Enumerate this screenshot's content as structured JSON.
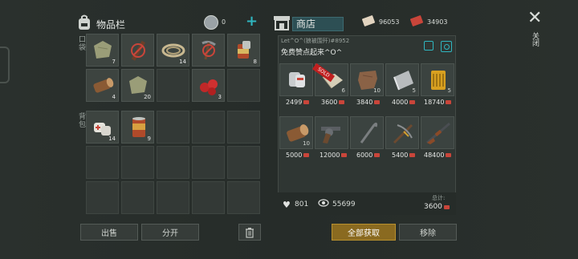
{
  "inventory": {
    "title": "物品栏",
    "coins": "0",
    "add_label": "+",
    "pocket_label": "口袋",
    "backpack_label": "背包",
    "pocket_counts": [
      "7",
      "",
      "14",
      "",
      "8",
      "4",
      "20",
      "",
      "3",
      ""
    ],
    "backpack_counts": [
      "14",
      "9"
    ]
  },
  "shop": {
    "title": "商店",
    "currency1": "96053",
    "currency2": "34903",
    "seller": "Let^O^(狼被围歼)",
    "seller_id": "#8952",
    "message": "免费赞点起来^O^",
    "sold_badge": "SOLD",
    "row1_counts": [
      "",
      "6",
      "10",
      "5",
      "5"
    ],
    "row1_prices": [
      "2499",
      "3600",
      "3840",
      "4000",
      "18740"
    ],
    "row2_counts": [
      "10",
      "",
      "",
      "",
      ""
    ],
    "row2_prices": [
      "5000",
      "12000",
      "6000",
      "5400",
      "48400"
    ],
    "likes": "801",
    "views": "55699",
    "total_label": "总计:",
    "total_value": "3600"
  },
  "buttons": {
    "sell": "出售",
    "split": "分开",
    "buy_all": "全部获取",
    "remove": "移除"
  },
  "close_label": "关闭",
  "colors": {
    "accent": "#2fb6c0",
    "gold": "#8a6a20",
    "ticket": "#c9453a"
  }
}
